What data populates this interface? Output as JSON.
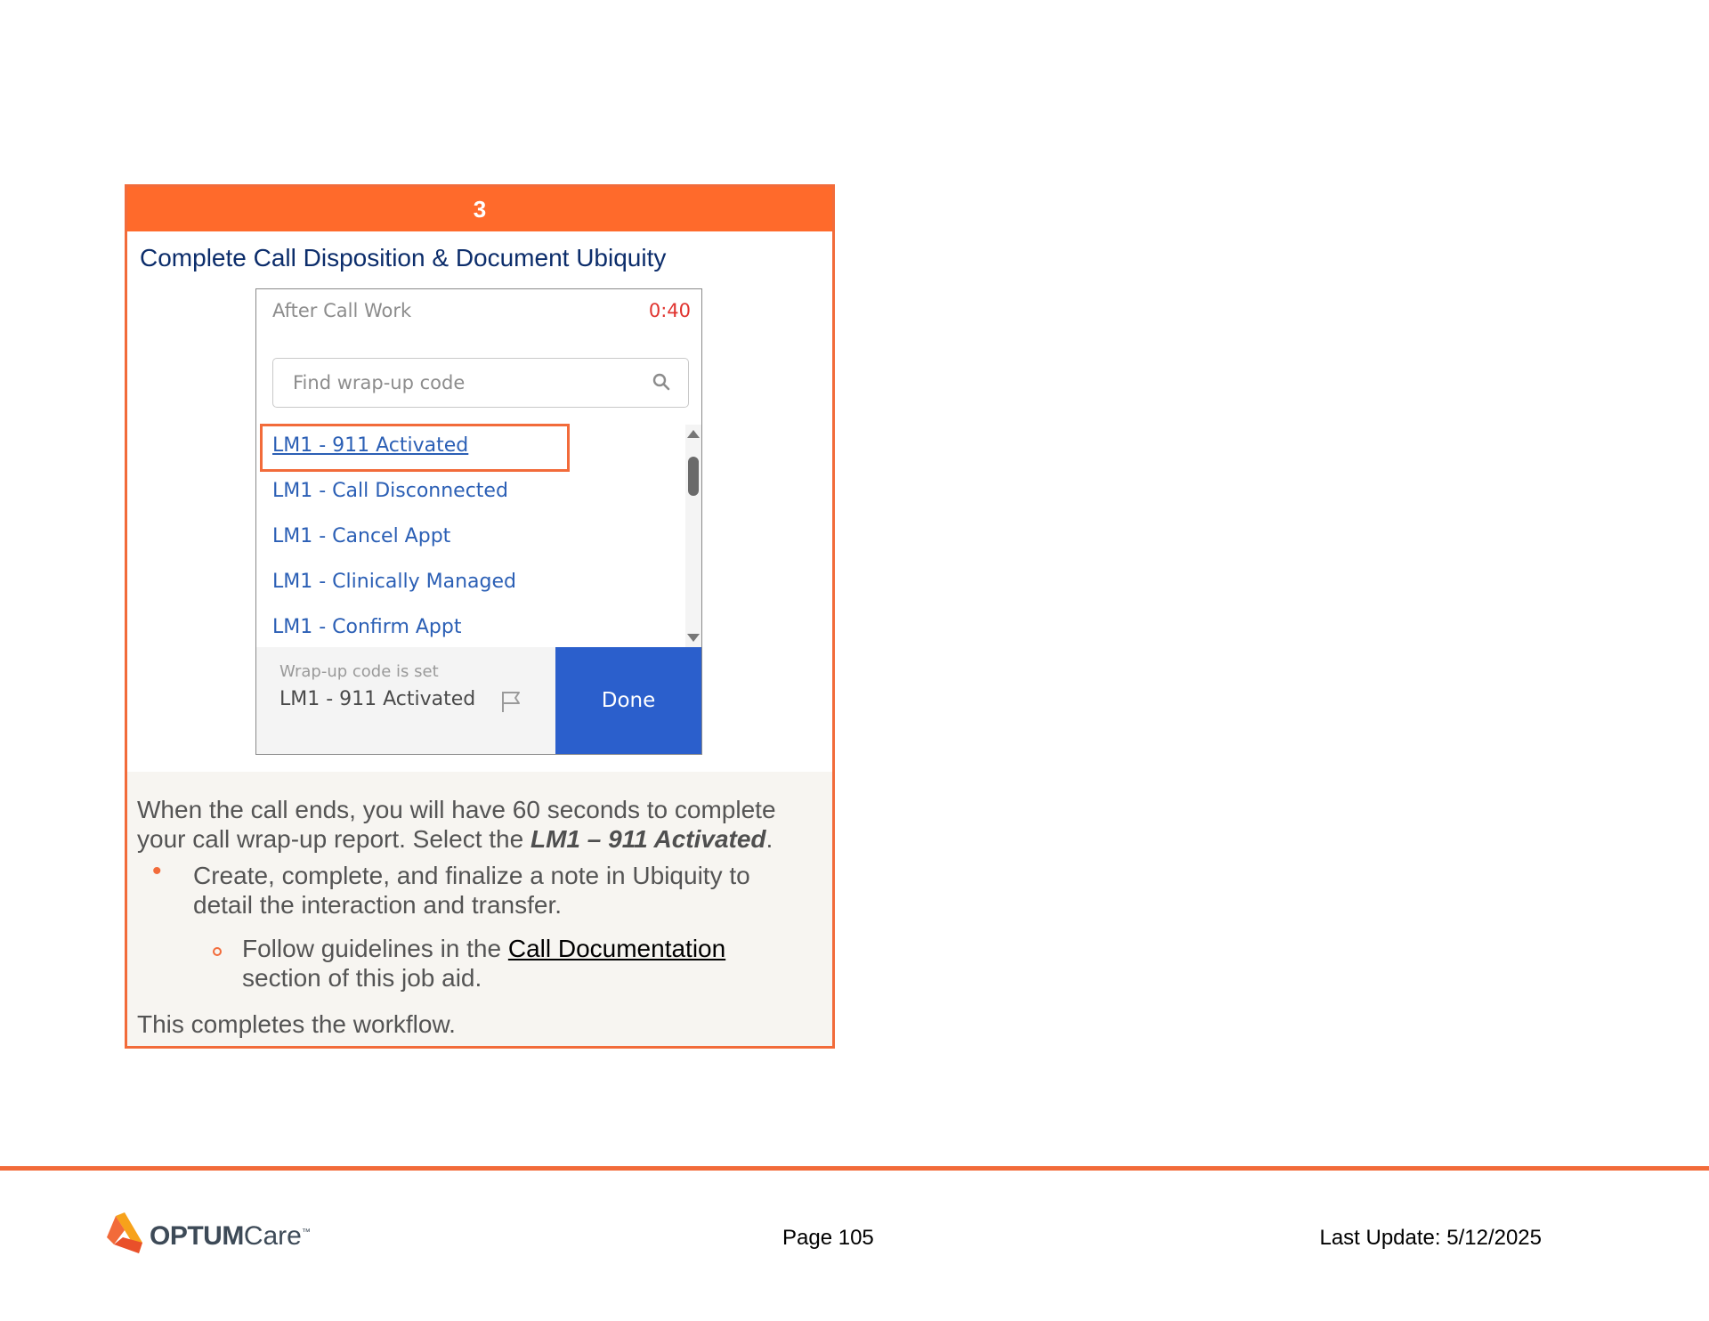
{
  "step": {
    "number": "3",
    "title": "Complete Call Disposition & Document Ubiquity"
  },
  "acw": {
    "title": "After Call Work",
    "timer": "0:40",
    "search_placeholder": "Find wrap-up code",
    "codes": [
      "LM1 - 911 Activated",
      "LM1 - Call Disconnected",
      "LM1 - Cancel Appt",
      "LM1 - Clinically Managed",
      "LM1 - Confirm Appt"
    ],
    "footer_caption": "Wrap-up code is set",
    "selected_code": "LM1 - 911 Activated",
    "done_label": "Done",
    "icons": [
      "search-icon",
      "flag-icon",
      "scroll-up-icon",
      "scroll-down-icon"
    ]
  },
  "body": {
    "intro": "When the call ends, you will have 60 seconds to complete your call wrap-up report. Select the ",
    "intro_bold": "LM1 – 911 Activated",
    "intro_end": ".",
    "bullet1": "Create, complete, and finalize a note in Ubiquity to detail the interaction and transfer.",
    "bullet2_pre": "Follow guidelines in the ",
    "bullet2_link": "Call Documentation",
    "bullet2_post": " section of this job aid.",
    "closing": "This completes the workflow."
  },
  "footer": {
    "logo_optum": "OPTUM",
    "logo_care": "Care",
    "logo_tm": "™",
    "page": "Page 105",
    "last_update": "Last Update: 5/12/2025"
  },
  "colors": {
    "accent": "#f26b3a",
    "header": "#ff6a2b",
    "title": "#0c2d6b",
    "link": "#2b5fb5",
    "done": "#2b5fcc",
    "timer": "#e0342f"
  }
}
